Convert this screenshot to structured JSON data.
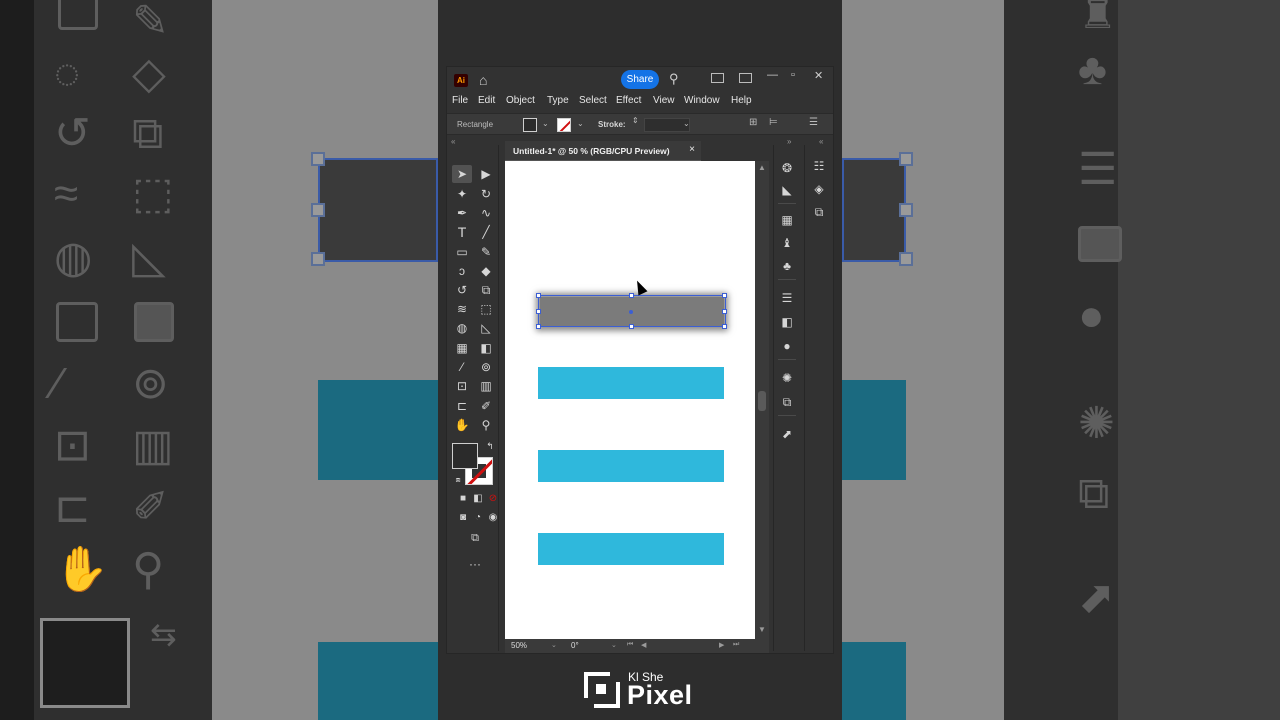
{
  "titlebar": {
    "app_logo": "Ai",
    "home_icon": "home-icon",
    "share_label": "Share",
    "search_icon": "search-icon"
  },
  "menu": [
    "File",
    "Edit",
    "Object",
    "Type",
    "Select",
    "Effect",
    "View",
    "Window",
    "Help"
  ],
  "control_bar": {
    "object_type": "Rectangle",
    "stroke_label": "Stroke:"
  },
  "document_tab": {
    "title": "Untitled-1* @ 50 % (RGB/CPU Preview)",
    "close": "×"
  },
  "status_bar": {
    "zoom": "50%",
    "rotation": "0°"
  },
  "artwork": {
    "shadow_rect_color": "#7b7b7b",
    "bar_color": "#2fb8dc",
    "bar_count": 3
  },
  "colors": {
    "accent": "#1473e6",
    "selection": "#3c5fd4",
    "ui_bg": "#323232"
  },
  "watermark": {
    "line1": "Kl She",
    "line2": "Pixel"
  }
}
